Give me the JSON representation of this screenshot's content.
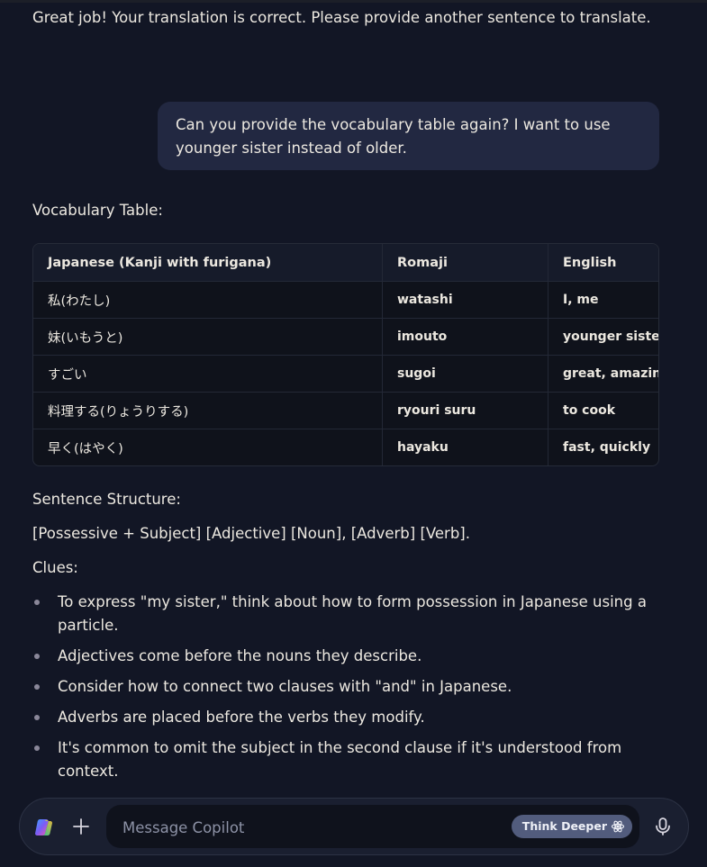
{
  "previous_assistant_message": "Great job! Your translation is correct. Please provide another sentence to translate.",
  "user_message": "Can you provide the vocabulary table again? I want to use younger sister instead of older.",
  "vocab_heading": "Vocabulary Table:",
  "vocab_table": {
    "headers": [
      "Japanese (Kanji with furigana)",
      "Romaji",
      "English"
    ],
    "rows": [
      [
        "私(わたし)",
        "watashi",
        "I, me"
      ],
      [
        "妹(いもうと)",
        "imouto",
        "younger sister"
      ],
      [
        "すごい",
        "sugoi",
        "great, amazing"
      ],
      [
        "料理する(りょうりする)",
        "ryouri suru",
        "to cook"
      ],
      [
        "早く(はやく)",
        "hayaku",
        "fast, quickly"
      ]
    ]
  },
  "structure_heading": "Sentence Structure:",
  "structure_text": "[Possessive + Subject] [Adjective] [Noun], [Adverb] [Verb].",
  "clues_heading": "Clues:",
  "clues": [
    "To express \"my sister,\" think about how to form possession in Japanese using a particle.",
    "Adjectives come before the nouns they describe.",
    "Consider how to connect two clauses with \"and\" in Japanese.",
    "Adverbs are placed before the verbs they modify.",
    "It's common to omit the subject in the second clause if it's understood from context."
  ],
  "composer": {
    "placeholder": "Message Copilot",
    "value": "",
    "think_deeper_label": "Think Deeper",
    "icons": {
      "logo": "copilot-logo-icon",
      "add": "plus-icon",
      "think": "atom-icon",
      "mic": "microphone-icon"
    }
  },
  "colors": {
    "background": "#121625",
    "user_bubble": "#222841",
    "table_header": "#161b2a",
    "think_button": "#525c7d"
  }
}
